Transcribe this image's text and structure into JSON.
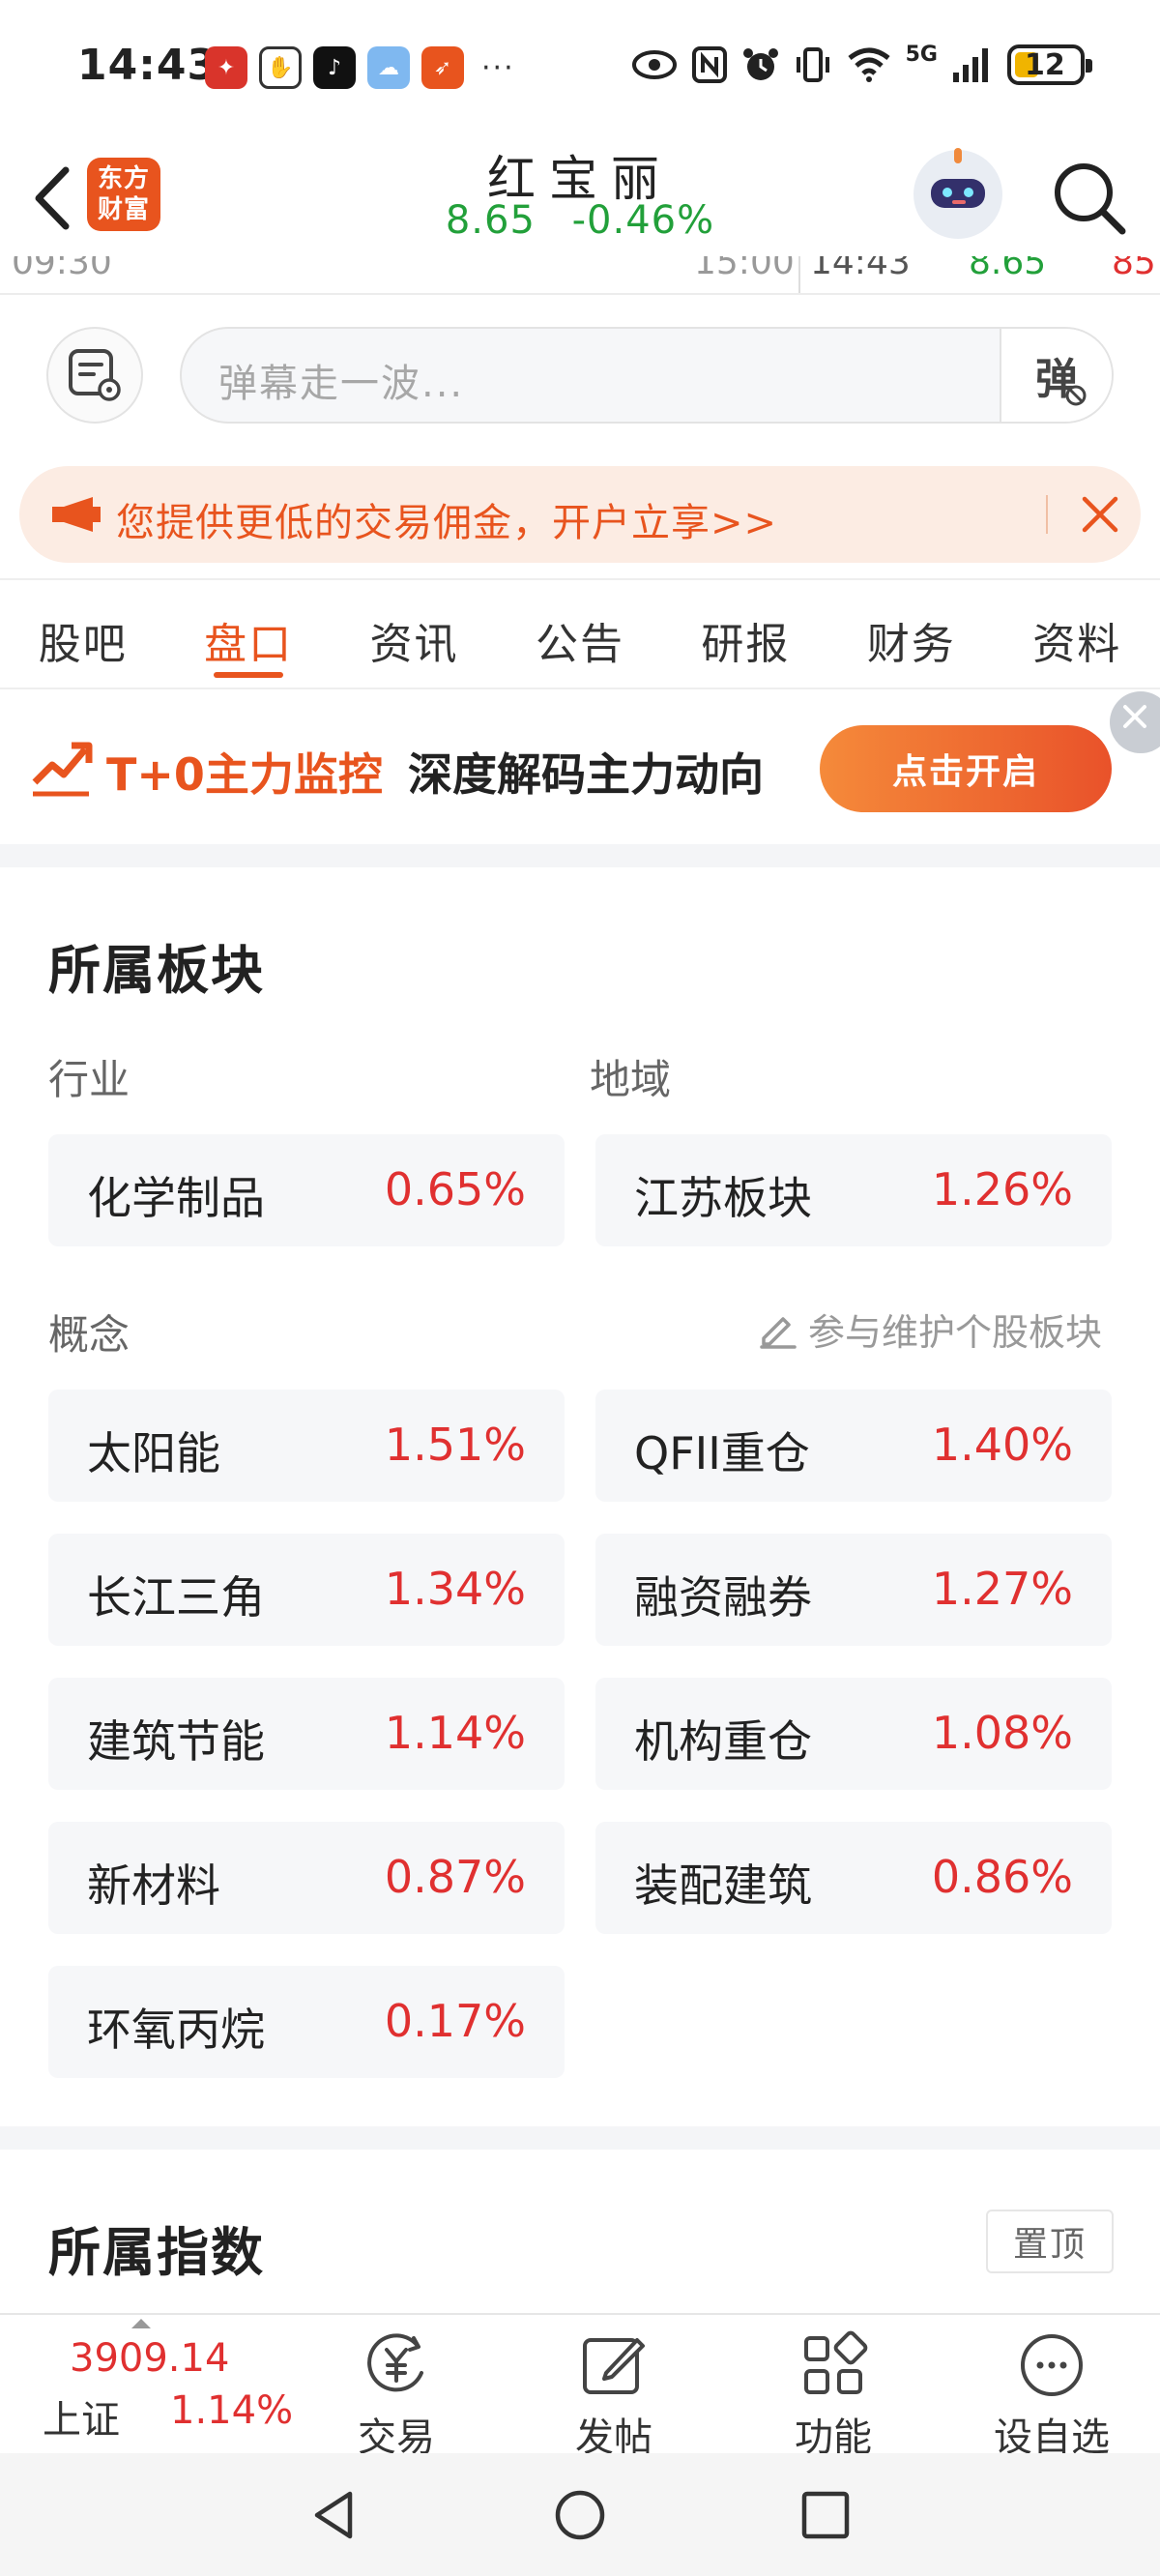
{
  "status_bar": {
    "time": "14:43",
    "network_label": "5G",
    "battery_level": "12"
  },
  "header": {
    "app_logo_text_line1": "东方",
    "app_logo_text_line2": "财富",
    "stock_name": "红宝丽",
    "price": "8.65",
    "change_pct": "-0.46%"
  },
  "chart_strip": {
    "start_time": "09:30",
    "end_time": "15:00",
    "cursor_time": "14:43",
    "cursor_price": "8.65",
    "cursor_extra": "85"
  },
  "danmaku": {
    "placeholder": "弹幕走一波...",
    "send_label": "弹"
  },
  "promo": {
    "text": "您提供更低的交易佣金，开户立享>>"
  },
  "tabs": [
    {
      "label": "股吧",
      "active": false
    },
    {
      "label": "盘口",
      "active": true
    },
    {
      "label": "资讯",
      "active": false
    },
    {
      "label": "公告",
      "active": false
    },
    {
      "label": "研报",
      "active": false
    },
    {
      "label": "财务",
      "active": false
    },
    {
      "label": "资料",
      "active": false
    }
  ],
  "ad_banner": {
    "title_highlight": "T+0主力监控",
    "title_rest": "深度解码主力动向",
    "button_label": "点击开启"
  },
  "sector": {
    "title": "所属板块",
    "industry_label": "行业",
    "region_label": "地域",
    "concept_label": "概念",
    "maintain_link": "参与维护个股板块",
    "industry": {
      "name": "化学制品",
      "value": "0.65%"
    },
    "region": {
      "name": "江苏板块",
      "value": "1.26%"
    },
    "concepts": [
      {
        "name": "太阳能",
        "value": "1.51%"
      },
      {
        "name": "QFII重仓",
        "value": "1.40%"
      },
      {
        "name": "长江三角",
        "value": "1.34%"
      },
      {
        "name": "融资融券",
        "value": "1.27%"
      },
      {
        "name": "建筑节能",
        "value": "1.14%"
      },
      {
        "name": "机构重仓",
        "value": "1.08%"
      },
      {
        "name": "新材料",
        "value": "0.87%"
      },
      {
        "name": "装配建筑",
        "value": "0.86%"
      },
      {
        "name": "环氧丙烷",
        "value": "0.17%"
      }
    ]
  },
  "index_section": {
    "title": "所属指数",
    "pin_label": "置顶"
  },
  "bottom_bar": {
    "index_value": "3909.14",
    "index_name": "上证",
    "index_pct": "1.14%",
    "tools": [
      {
        "label": "交易",
        "icon": "yuan-circle-icon"
      },
      {
        "label": "发帖",
        "icon": "edit-icon"
      },
      {
        "label": "功能",
        "icon": "grid-icon"
      },
      {
        "label": "设自选",
        "icon": "more-circle-icon"
      }
    ]
  },
  "colors": {
    "brand": "#e8541e",
    "up": "#e03030",
    "down": "#22a03a"
  }
}
